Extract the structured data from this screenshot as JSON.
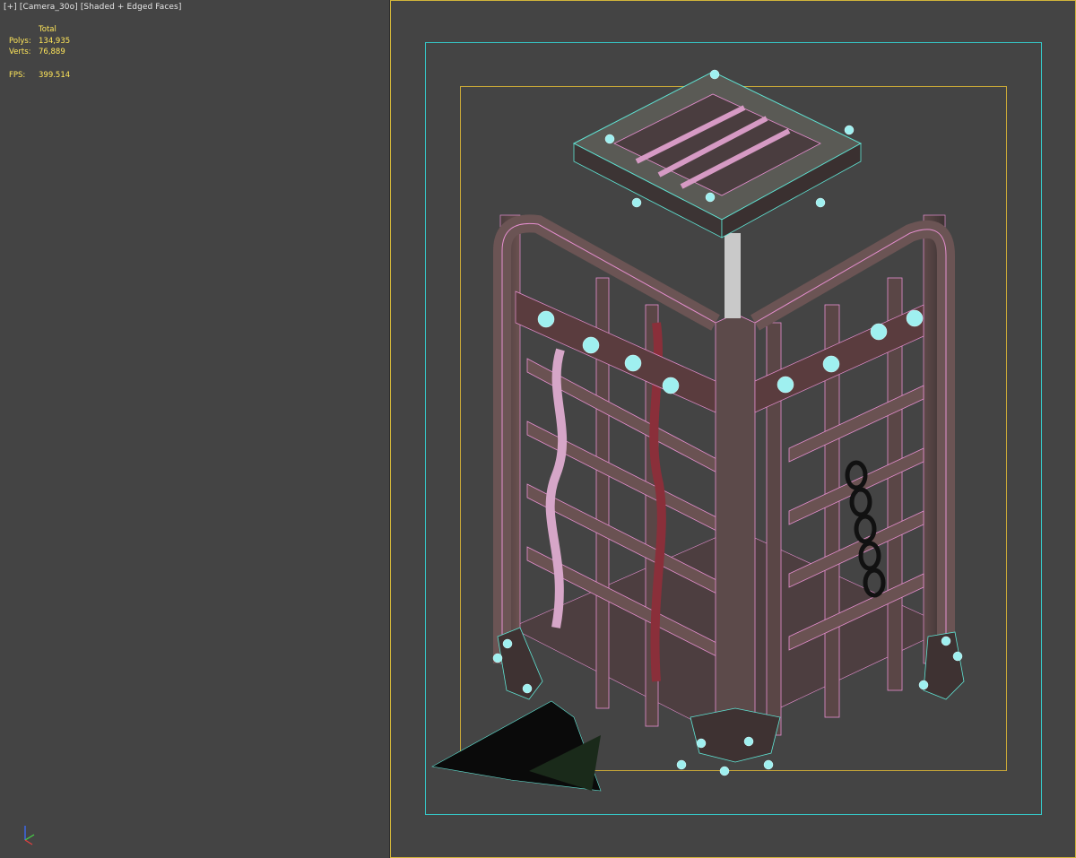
{
  "viewport_left": {
    "label": {
      "plus": "[+]",
      "camera": "[Camera_30o]",
      "mode": "[Shaded + Edged Faces]"
    },
    "stats": {
      "total_label": "Total",
      "polys_label": "Polys:",
      "polys_value": "134,935",
      "verts_label": "Verts:",
      "verts_value": "76,889",
      "fps_label": "FPS:",
      "fps_value": "399.514"
    }
  },
  "colors": {
    "background": "#444444",
    "active_viewport_border": "#d1b53a",
    "safe_frame_outer": "#36c7c7",
    "safe_frame_inner": "#c9a838",
    "stats_text": "#ffe65a",
    "wire_pink": "#e68fd0",
    "wire_cyan": "#5fe3d3",
    "rivet": "#9ff0f0"
  },
  "scene": {
    "object": "cage-model",
    "icons": [
      "axis-gizmo-icon"
    ]
  }
}
